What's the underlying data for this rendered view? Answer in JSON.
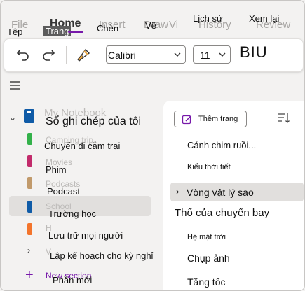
{
  "ribbon": {
    "ghost_tabs": [
      "File",
      "Home",
      "Insert",
      "Draw",
      "View",
      "History",
      "Review"
    ],
    "tab_labels": [
      "Tệp",
      "Trang",
      "Chèn",
      "Vẽ",
      "Lịch sử",
      "Xem lại"
    ]
  },
  "toolbar": {
    "font_name": "Calibri",
    "font_size": "11",
    "format_text": "BIU"
  },
  "notebook": {
    "title": "Sổ ghi chép của tôi",
    "ghost_title": "My Notebook"
  },
  "sections": [
    {
      "label": "Chuyến đi cắm trại",
      "ghost": "Camping trip",
      "color": "#33b14a"
    },
    {
      "label": "Phim",
      "ghost": "Movies",
      "color": "#c22b6b"
    },
    {
      "label": "Podcast",
      "ghost": "Podcasts",
      "color": "#c19a6b"
    },
    {
      "label": "Trường học",
      "ghost": "School",
      "color": "#0f5ba7"
    },
    {
      "label": "Lưu trữ mọi người",
      "ghost": "H",
      "color": "#f3742b"
    },
    {
      "label": "Lập kế hoạch cho kỳ nghỉ",
      "ghost": "V",
      "color": ""
    }
  ],
  "new_section": {
    "label": "Phần mới",
    "ghost": "New section"
  },
  "pages_pane": {
    "add_page_label": "Thêm trang",
    "pages": [
      {
        "label": "Cánh chim ruồi...",
        "level": 1
      },
      {
        "label": "Kiểu thời tiết",
        "level": 2
      },
      {
        "label": "Vòng vật lý sao",
        "level": 1
      },
      {
        "label": "Thổ của chuyến bay",
        "level": 0
      },
      {
        "label": "Hệ mặt trời",
        "level": 2
      },
      {
        "label": "Chụp ảnh",
        "level": 1
      },
      {
        "label": "Tăng tốc",
        "level": 1
      }
    ]
  },
  "colors": {
    "accent": "#7719aa",
    "selection": "#e1dfdd"
  }
}
